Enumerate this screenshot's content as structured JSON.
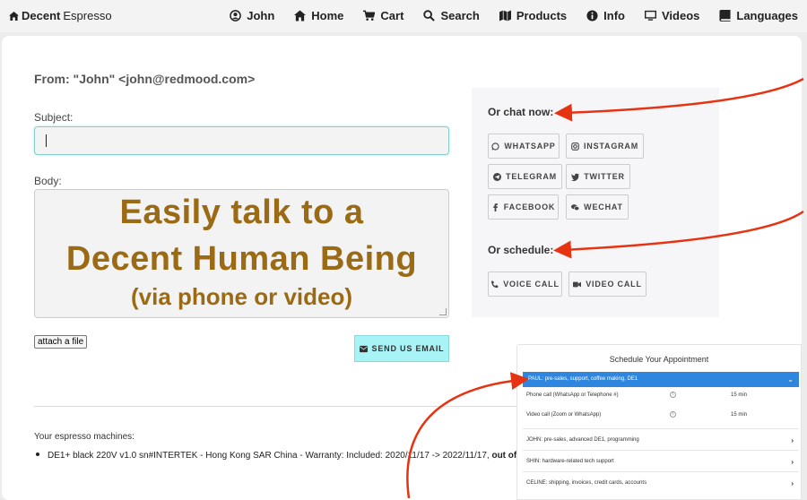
{
  "brand": {
    "bold": "Decent",
    "light": "Espresso"
  },
  "nav": [
    {
      "icon": "user-circle-icon",
      "label": "John"
    },
    {
      "icon": "home-icon",
      "label": "Home"
    },
    {
      "icon": "cart-icon",
      "label": "Cart"
    },
    {
      "icon": "search-icon",
      "label": "Search"
    },
    {
      "icon": "map-icon",
      "label": "Products"
    },
    {
      "icon": "info-icon",
      "label": "Info"
    },
    {
      "icon": "monitor-icon",
      "label": "Videos"
    },
    {
      "icon": "book-icon",
      "label": "Languages"
    }
  ],
  "form": {
    "from": "From: \"John\" <john@redmood.com>",
    "subject_label": "Subject:",
    "subject_value": "",
    "body_label": "Body:",
    "headline_1": "Easily talk to a",
    "headline_2": "Decent Human Being",
    "headline_3": "(via phone or video)",
    "attach_label": "attach a file",
    "send_label": "SEND US EMAIL"
  },
  "chat": {
    "chat_heading": "Or chat now:",
    "buttons": [
      "WHATSAPP",
      "INSTAGRAM",
      "TELEGRAM",
      "TWITTER",
      "FACEBOOK",
      "WECHAT"
    ],
    "schedule_heading": "Or schedule:",
    "schedule_buttons": [
      "VOICE CALL",
      "VIDEO CALL"
    ]
  },
  "machines": {
    "title": "Your espresso machines:",
    "item_text": "DE1+ black 220V v1.0 sn#INTERTEK - Hong Kong SAR China - Warranty: Included: 2020/11/17 -> 2022/11/17, ",
    "item_bold": "out of warran"
  },
  "schedule": {
    "title": "Schedule Your Appointment",
    "selected": "PAUL: pre-sales, support, coffee making, DE1",
    "options": [
      {
        "label": "Phone call (WhatsApp or Telephone #)",
        "duration": "15 min"
      },
      {
        "label": "Video call (Zoom or WhatsApp)",
        "duration": "15 min"
      }
    ],
    "people": [
      "JOHN: pre-sales, advanced DE1, programming",
      "SHIN: hardware-related tech support",
      "CELINE: shipping, invoices, credit cards, accounts"
    ]
  },
  "colors": {
    "accent_headline": "#9a6b14",
    "send_button": "#a8f3f6",
    "schedule_highlight": "#2e86de",
    "arrow": "#e63312"
  }
}
